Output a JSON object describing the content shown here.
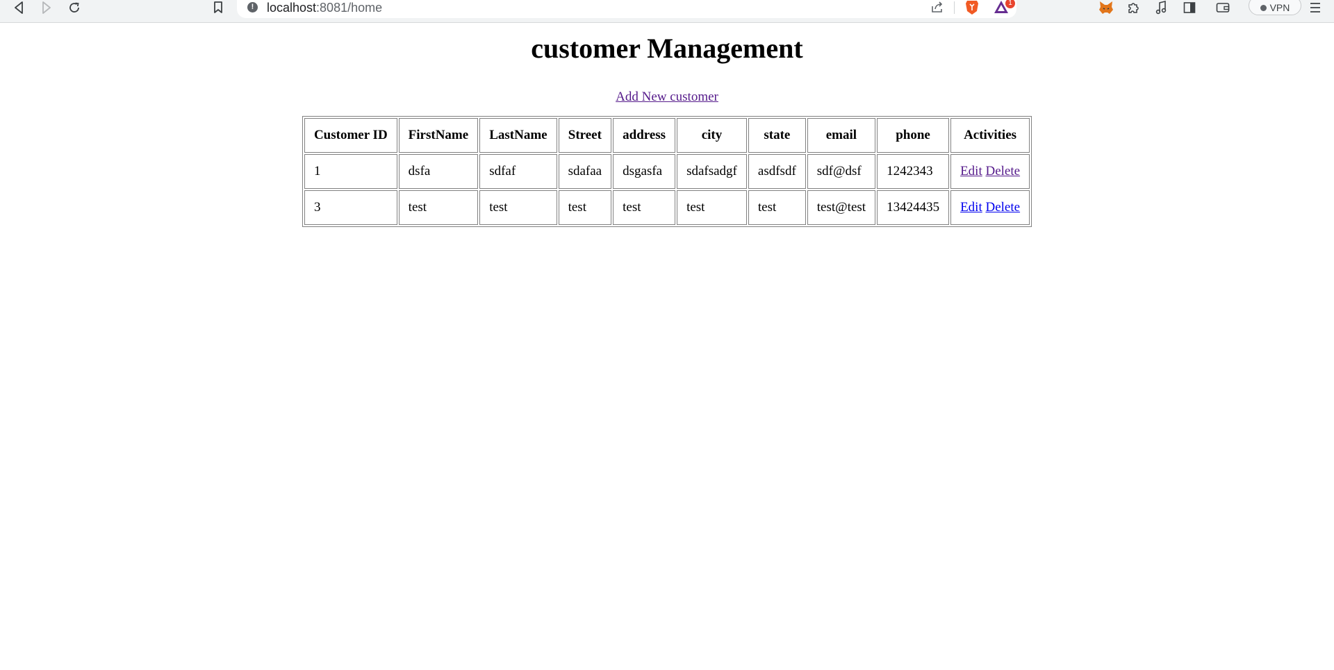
{
  "browser": {
    "url_host": "localhost",
    "url_rest": ":8081/home",
    "vpn_label": "VPN",
    "notification_count": "1"
  },
  "page": {
    "title": "customer Management",
    "add_link": "Add New customer"
  },
  "table": {
    "headers": [
      "Customer ID",
      "FirstName",
      "LastName",
      "Street",
      "address",
      "city",
      "state",
      "email",
      "phone",
      "Activities"
    ],
    "rows": [
      {
        "id": "1",
        "first": "dsfa",
        "last": "sdfaf",
        "street": "sdafaa",
        "address": "dsgasfa",
        "city": "sdafsadgf",
        "state": "asdfsdf",
        "email": "sdf@dsf",
        "phone": "1242343",
        "edit": "Edit",
        "delete": "Delete"
      },
      {
        "id": "3",
        "first": "test",
        "last": "test",
        "street": "test",
        "address": "test",
        "city": "test",
        "state": "test",
        "email": "test@test",
        "phone": "13424435",
        "edit": "Edit",
        "delete": "Delete"
      }
    ]
  },
  "icons": {
    "back": "back-icon",
    "forward": "forward-icon",
    "reload": "reload-icon",
    "bookmark": "bookmark-icon",
    "share": "share-icon",
    "brave": "brave-shield-icon",
    "rewards": "brave-rewards-icon",
    "metamask": "metamask-icon",
    "extensions": "puzzle-icon",
    "media": "music-icon",
    "sidebar": "sidebar-icon",
    "wallet": "wallet-icon",
    "menu": "menu-icon"
  },
  "colors": {
    "visited_link": "#551a8b",
    "unvisited_link": "#0000ee",
    "chrome_bg": "#f1f3f4"
  }
}
